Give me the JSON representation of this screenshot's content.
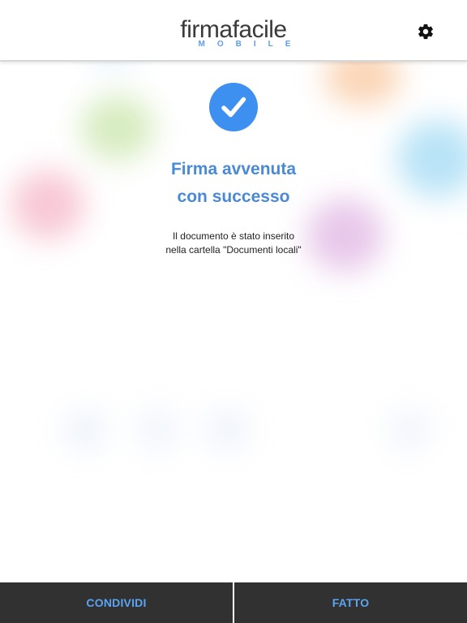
{
  "header": {
    "logo_part1": "firma",
    "logo_part2": "facile",
    "logo_sub": "MOBILE",
    "settings_icon": "gear-icon"
  },
  "content": {
    "status_icon": "check-circle-icon",
    "title_line1": "Firma avvenuta",
    "title_line2": "con successo",
    "desc_line1": "Il documento è stato inserito",
    "desc_line2": "nella cartella \"Documenti locali\""
  },
  "actions": {
    "share_label": "CONDIVIDI",
    "done_label": "FATTO"
  },
  "colors": {
    "accent": "#3d8ff0",
    "title_blue": "#4a8ad4",
    "button_bg": "#313131",
    "button_text": "#5aa5f2"
  }
}
